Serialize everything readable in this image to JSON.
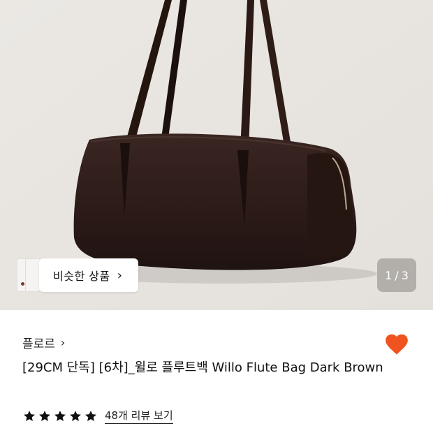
{
  "similar": {
    "label": "비슷한 상품"
  },
  "pager": {
    "current": "1",
    "separator": "/",
    "total": "3"
  },
  "product": {
    "brand": "플로르",
    "title": "[29CM 단독] [6차]_윌로 플루트백 Willo Flute Bag Dark Brown",
    "rating": 5,
    "review_link": "48개 리뷰 보기",
    "wishlisted": true
  },
  "colors": {
    "heart": "#f0531f",
    "image_bg": "#e9e6e2",
    "bag": "#2c1b17"
  },
  "icons": {
    "brand_chevron": "chevron-right-icon",
    "similar_chevron": "chevron-right-icon",
    "wishlist": "heart-icon",
    "star": "star-icon"
  }
}
